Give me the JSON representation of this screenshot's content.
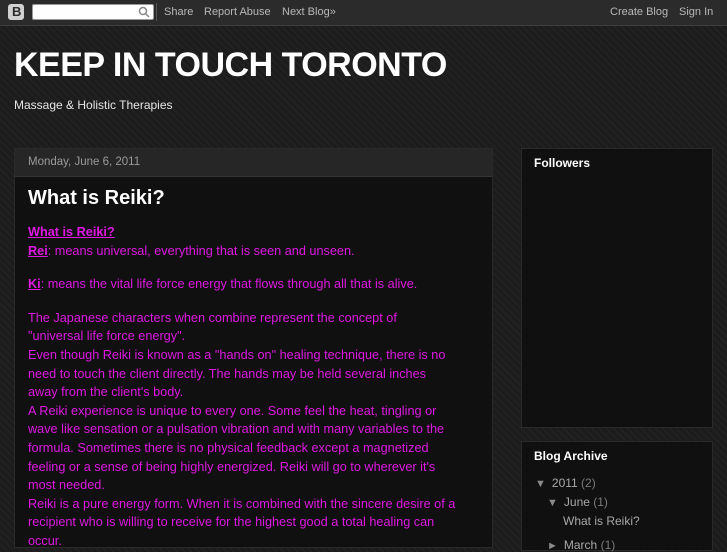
{
  "navbar": {
    "logo_letter": "B",
    "search": {
      "value": "",
      "placeholder": ""
    },
    "links": [
      "Share",
      "Report Abuse",
      "Next Blog»"
    ],
    "create_blog": "Create Blog",
    "sign_in": "Sign In"
  },
  "header": {
    "title": "KEEP IN TOUCH TORONTO",
    "description": "Massage & Holistic Therapies"
  },
  "post": {
    "date": "Monday, June 6, 2011",
    "title": "What is Reiki?",
    "heading_link": "What is Reiki?",
    "rei_term": "Rei",
    "rei_text": ": means universal, everything that is seen and unseen.",
    "ki_term": "Ki",
    "ki_text": ": means the vital life force energy that flows through all that is alive.",
    "lines": [
      "The Japanese characters when combine represent the concept of",
      "\"universal life force energy\".",
      "Even though Reiki is known as a \"hands on\" healing technique, there is no",
      "need to touch the client directly. The hands may be held several inches",
      "away from the client's body.",
      "A Reiki experience is unique to every one. Some feel the heat, tingling or",
      "wave like sensation or a pulsation vibration and with many variables to the",
      "formula. Sometimes there is no physical feedback except a magnetized",
      "feeling or a sense of being highly energized. Reiki will go to wherever it's",
      "most needed.",
      "Reiki is a pure energy form. When it is combined with the sincere desire of a",
      "recipient who is willing to receive for the highest good a total healing can",
      "occur."
    ]
  },
  "sidebar": {
    "followers_title": "Followers",
    "archive_title": "Blog Archive",
    "archive": {
      "year": "2011",
      "year_count": "(2)",
      "month": "June",
      "month_count": "(1)",
      "post": "What is Reiki?",
      "month2": "March",
      "month2_count": "(1)"
    }
  },
  "colors": {
    "post_text": "#dd19e0",
    "background": "#1c1c1c"
  }
}
